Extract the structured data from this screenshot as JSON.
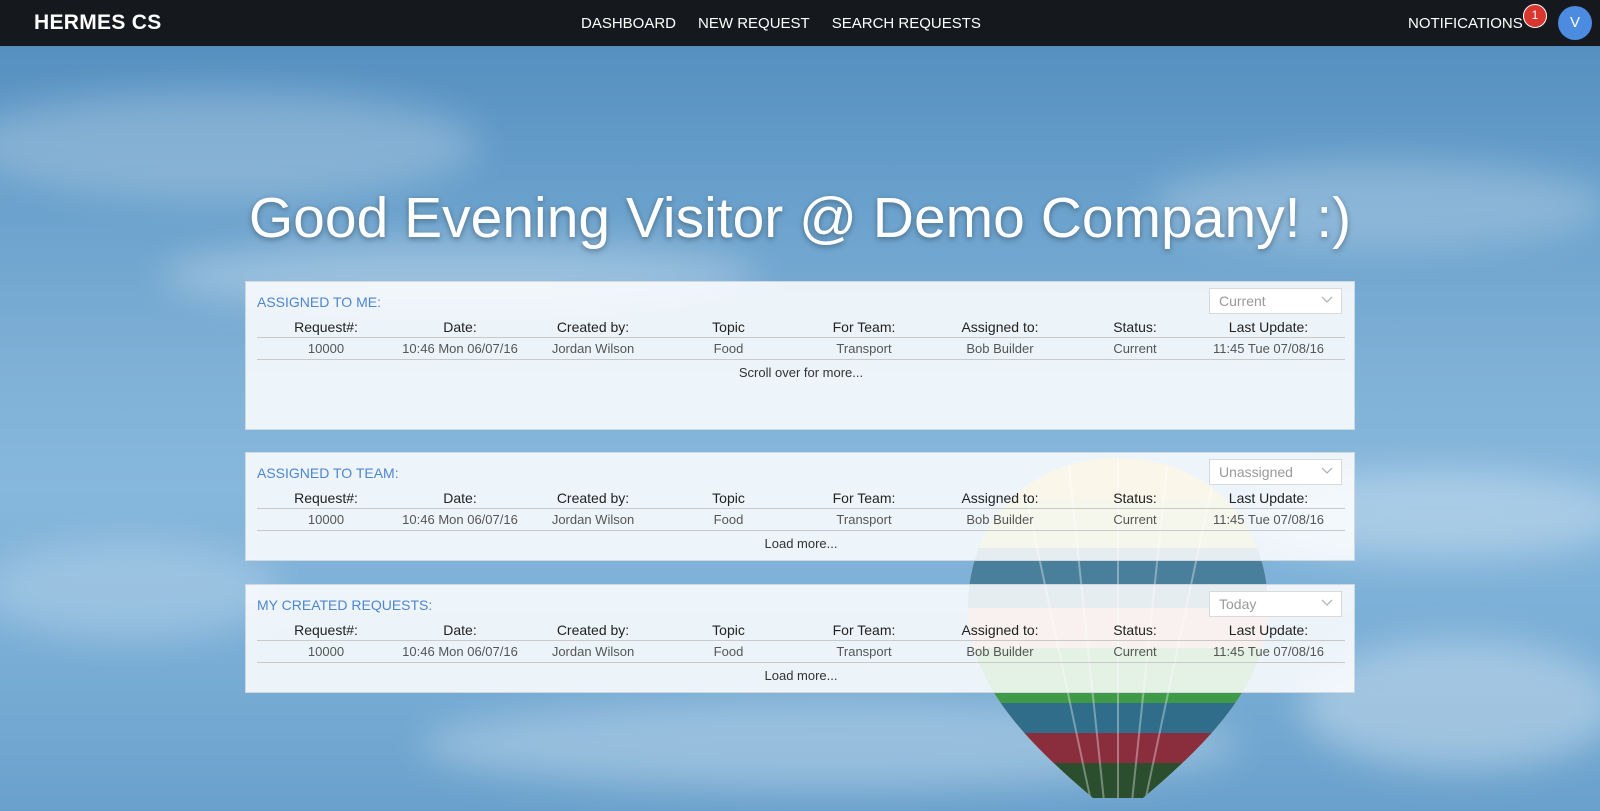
{
  "header": {
    "brand": "HERMES CS",
    "nav": [
      "DASHBOARD",
      "NEW REQUEST",
      "SEARCH REQUESTS"
    ],
    "notifications_label": "NOTIFICATIONS",
    "notifications_count": "1",
    "avatar_initial": "V"
  },
  "greeting": "Good Evening Visitor @ Demo Company! :)",
  "columns": [
    "Request#:",
    "Date:",
    "Created by:",
    "Topic",
    "For Team:",
    "Assigned to:",
    "Status:",
    "Last Update:"
  ],
  "panels": [
    {
      "title": "ASSIGNED TO ME:",
      "filter": "Current",
      "row": [
        "10000",
        "10:46 Mon 06/07/16",
        "Jordan Wilson",
        "Food",
        "Transport",
        "Bob Builder",
        "Current",
        "11:45 Tue 07/08/16"
      ],
      "footer": "Scroll over for more..."
    },
    {
      "title": "ASSIGNED TO TEAM:",
      "filter": "Unassigned",
      "row": [
        "10000",
        "10:46 Mon 06/07/16",
        "Jordan Wilson",
        "Food",
        "Transport",
        "Bob Builder",
        "Current",
        "11:45 Tue 07/08/16"
      ],
      "footer": "Load more..."
    },
    {
      "title": "MY CREATED REQUESTS:",
      "filter": "Today",
      "row": [
        "10000",
        "10:46 Mon 06/07/16",
        "Jordan Wilson",
        "Food",
        "Transport",
        "Bob Builder",
        "Current",
        "11:45 Tue 07/08/16"
      ],
      "footer": "Load more..."
    }
  ],
  "icons": {
    "dropdown": "chevron-down-icon",
    "background": "hot-air-balloon-icon"
  },
  "colors": {
    "topbar": "#15191d",
    "accent": "#4d86d1",
    "badge": "#d9362f",
    "avatar": "#4b8be0"
  }
}
